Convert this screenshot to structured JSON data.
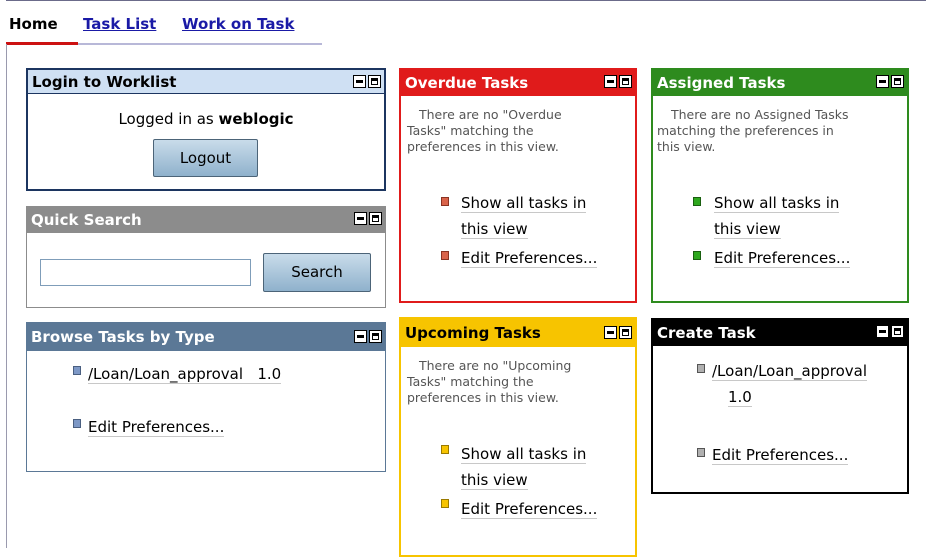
{
  "nav": {
    "home": "Home",
    "task_list": "Task List",
    "work_on_task": "Work on Task"
  },
  "login": {
    "title": "Login to Worklist",
    "logged_in_prefix": "Logged in as",
    "user": "weblogic",
    "logout": "Logout",
    "color": "#cfe0f3"
  },
  "quick_search": {
    "title": "Quick Search",
    "search_button": "Search",
    "input_value": "",
    "color": "#8c8c8c"
  },
  "browse": {
    "title": "Browse Tasks by Type",
    "item1": "/Loan/Loan_approval   1.0",
    "item2": "Edit Preferences...",
    "color": "#5b7896"
  },
  "overdue": {
    "title": "Overdue Tasks",
    "msg_l1": "There are no \"Overdue",
    "msg_l2": "Tasks\" matching the",
    "msg_l3": "preferences in this view.",
    "link1_a": "Show all tasks in",
    "link1_b": "this view",
    "link2": "Edit Preferences...",
    "color": "#e01b1b"
  },
  "assigned": {
    "title": "Assigned Tasks",
    "msg_l1": "There are no Assigned Tasks",
    "msg_l2": "matching the preferences in",
    "msg_l3": "this view.",
    "link1_a": "Show all tasks in",
    "link1_b": "this view",
    "link2": "Edit Preferences...",
    "color": "#2e8b1e"
  },
  "upcoming": {
    "title": "Upcoming Tasks",
    "msg_l1": "There are no \"Upcoming",
    "msg_l2": "Tasks\" matching the",
    "msg_l3": "preferences in this view.",
    "link1_a": "Show all tasks in",
    "link1_b": "this view",
    "link2": "Edit Preferences...",
    "color": "#f7c400"
  },
  "create": {
    "title": "Create Task",
    "item1_a": "/Loan/Loan_approval",
    "item1_b": "1.0",
    "item2": "Edit Preferences...",
    "color": "#000000"
  }
}
